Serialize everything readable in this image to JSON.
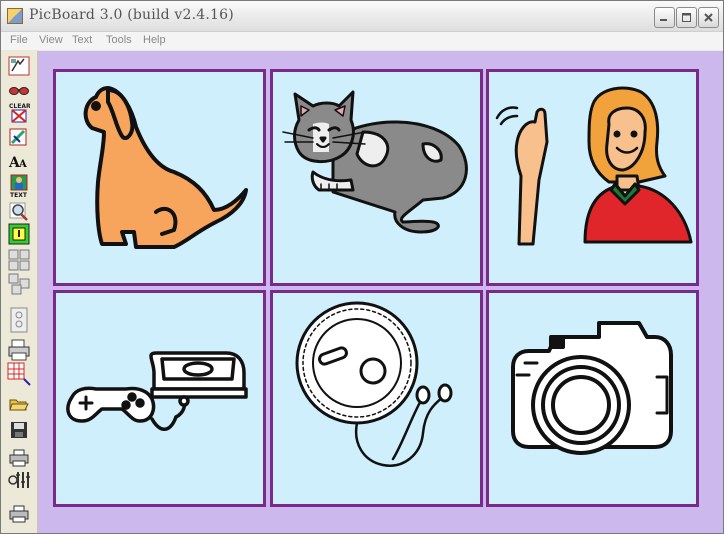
{
  "window": {
    "title": "PicBoard 3.0 (build v2.4.16)",
    "buttons": [
      "minimize-button",
      "maximize-button",
      "close-button"
    ]
  },
  "menu": {
    "items": [
      "File",
      "View",
      "Text",
      "Tools",
      "Help"
    ]
  },
  "toolbar": {
    "tools": [
      {
        "name": "paint-tool-icon"
      },
      {
        "name": "glasses-icon"
      },
      {
        "name": "clear-icon",
        "label": "CLEAR"
      },
      {
        "name": "edit-picture-icon"
      },
      {
        "name": "font-size-icon",
        "label": "AA"
      },
      {
        "name": "text-picture-icon",
        "label": "TEXT"
      },
      {
        "name": "zoom-icon"
      },
      {
        "name": "select-cell-icon"
      },
      {
        "name": "grid-layout-icon-1"
      },
      {
        "name": "grid-layout-icon-2"
      },
      {
        "name": "grid-layout-icon-3"
      },
      {
        "name": "printer-layout-icon"
      },
      {
        "name": "grid-resize-icon"
      },
      {
        "name": "open-folder-icon"
      },
      {
        "name": "save-icon"
      },
      {
        "name": "print-icon"
      },
      {
        "name": "tools-icon"
      },
      {
        "name": "print-preview-icon"
      }
    ]
  },
  "board": {
    "background": "#cdb8ee",
    "cell_border": "#7a2a8a",
    "cell_fill": "#cfeffc",
    "cells": [
      {
        "name": "dog-picture"
      },
      {
        "name": "cat-picture"
      },
      {
        "name": "waving-woman-picture"
      },
      {
        "name": "game-console-picture"
      },
      {
        "name": "cd-player-picture"
      },
      {
        "name": "camera-picture"
      }
    ]
  }
}
